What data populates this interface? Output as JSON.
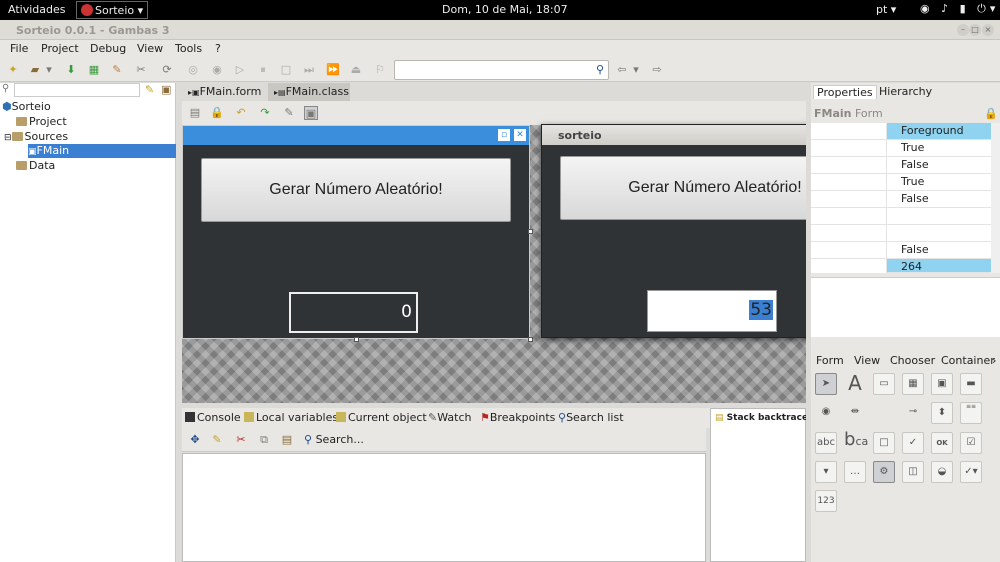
{
  "topbar": {
    "activities": "Atividades",
    "app_name": "Sorteio ▾",
    "clock": "Dom, 10 de Mai, 18:07",
    "lang": "pt ▾",
    "sys_icons": "◉ ♪ ▮ ⏻▾"
  },
  "window": {
    "title": "Sorteio 0.0.1 - Gambas 3"
  },
  "menu": {
    "file": "File",
    "project": "Project",
    "debug": "Debug",
    "view": "View",
    "tools": "Tools",
    "help": "?"
  },
  "project_tree": {
    "root": "Sorteio",
    "project": "Project",
    "sources": "Sources",
    "fmain": "FMain",
    "data": "Data"
  },
  "tabs": {
    "form": "FMain.form",
    "class": "FMain.class"
  },
  "design_form": {
    "button_label": "Gerar Número Aleatório!",
    "value": "0"
  },
  "run_window": {
    "title": "sorteio",
    "button_label": "Gerar Número Aleatório!",
    "value": "53"
  },
  "debug_tabs": {
    "console": "Console",
    "local_variables": "Local variables",
    "current_object": "Current object",
    "watch": "Watch",
    "breakpoints": "Breakpoints",
    "search_list": "Search list",
    "search_placeholder": "Search...",
    "stack_backtrace": "Stack backtrace"
  },
  "right_panel": {
    "tab_properties": "Properties",
    "tab_hierarchy": "Hierarchy",
    "form_label": "FMain",
    "form_type": "Form",
    "property_values": [
      "Foreground",
      "True",
      "False",
      "True",
      "False",
      "",
      "",
      "False",
      "264"
    ],
    "toolbox_tabs": {
      "form": "Form",
      "view": "View",
      "chooser": "Chooser",
      "container": "Container"
    },
    "toolbox_labels": {
      "label": "A",
      "abc": "abc",
      "ok": "OK",
      "numbers": "123",
      "bca": "b",
      "ca": "ca"
    }
  },
  "colors": {
    "selection": "#3b7fd2",
    "design_titlebar": "#3b8edb",
    "form_bg": "#2f3336",
    "highlight_row": "#8fd3f0",
    "value_highlight": "#3b7fd2"
  }
}
